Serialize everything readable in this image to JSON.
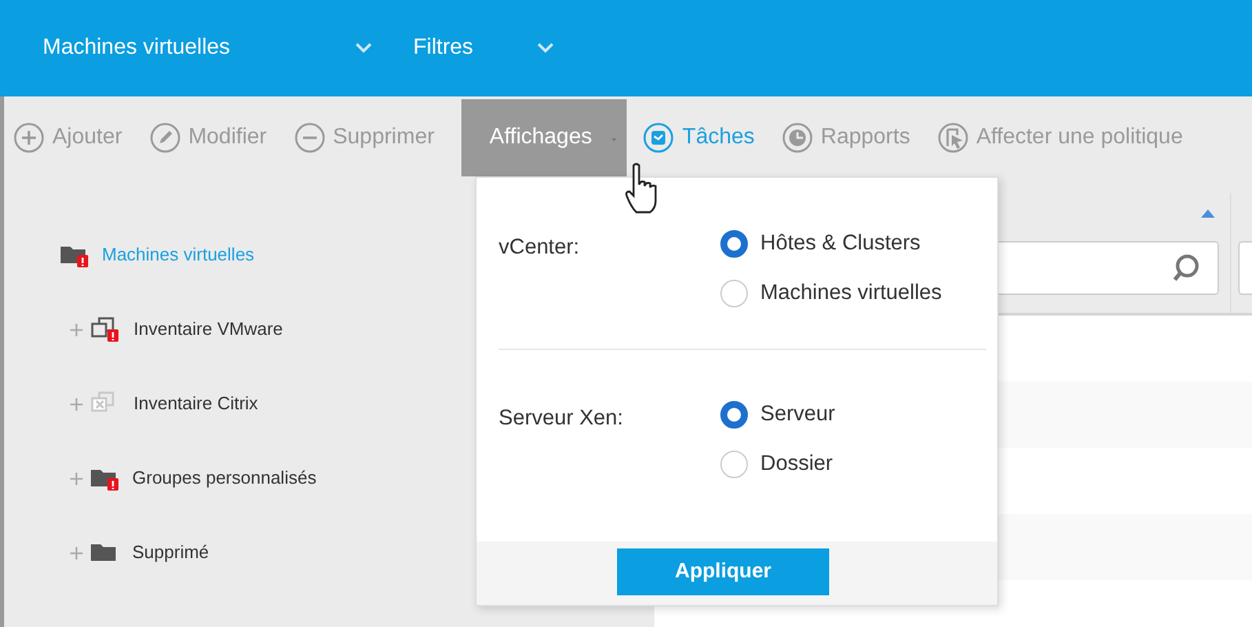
{
  "top_bar": {
    "items": [
      {
        "label": "Machines virtuelles"
      },
      {
        "label": "Filtres"
      }
    ]
  },
  "toolbar": {
    "buttons": [
      {
        "label": "Ajouter",
        "kind": "action",
        "highlighted": false
      },
      {
        "label": "Modifier",
        "kind": "action",
        "highlighted": false
      },
      {
        "label": "Supprimer",
        "kind": "action",
        "highlighted": false
      },
      {
        "label": "Affichages",
        "kind": "menu",
        "expanded": true
      },
      {
        "label": "Tâches",
        "kind": "action",
        "highlighted": true
      },
      {
        "label": "Rapports",
        "kind": "action",
        "highlighted": false
      },
      {
        "label": "Affecter une politique",
        "kind": "action",
        "highlighted": false
      }
    ]
  },
  "sidebar": {
    "tree": [
      {
        "label": "Machines virtuelles",
        "selected": true,
        "alert": true,
        "children": [
          {
            "label": "Inventaire VMware",
            "kind": "inventory",
            "expanded": false,
            "alert": true,
            "disabled": false
          },
          {
            "label": "Inventaire Citrix",
            "kind": "inventory",
            "expanded": false,
            "alert": false,
            "disabled": true
          },
          {
            "label": "Groupes personnalisés",
            "kind": "folder",
            "expanded": false,
            "alert": true,
            "disabled": false
          },
          {
            "label": "Supprimé",
            "kind": "folder",
            "expanded": false,
            "alert": false,
            "disabled": false
          }
        ]
      }
    ]
  },
  "views_menu": {
    "groups": [
      {
        "label": "vCenter:",
        "options": [
          {
            "label": "Hôtes & Clusters",
            "selected": true
          },
          {
            "label": "Machines virtuelles",
            "selected": false
          }
        ]
      },
      {
        "label": "Serveur Xen:",
        "options": [
          {
            "label": "Serveur",
            "selected": true
          },
          {
            "label": "Dossier",
            "selected": false
          }
        ]
      }
    ],
    "apply_button": "Appliquer"
  }
}
